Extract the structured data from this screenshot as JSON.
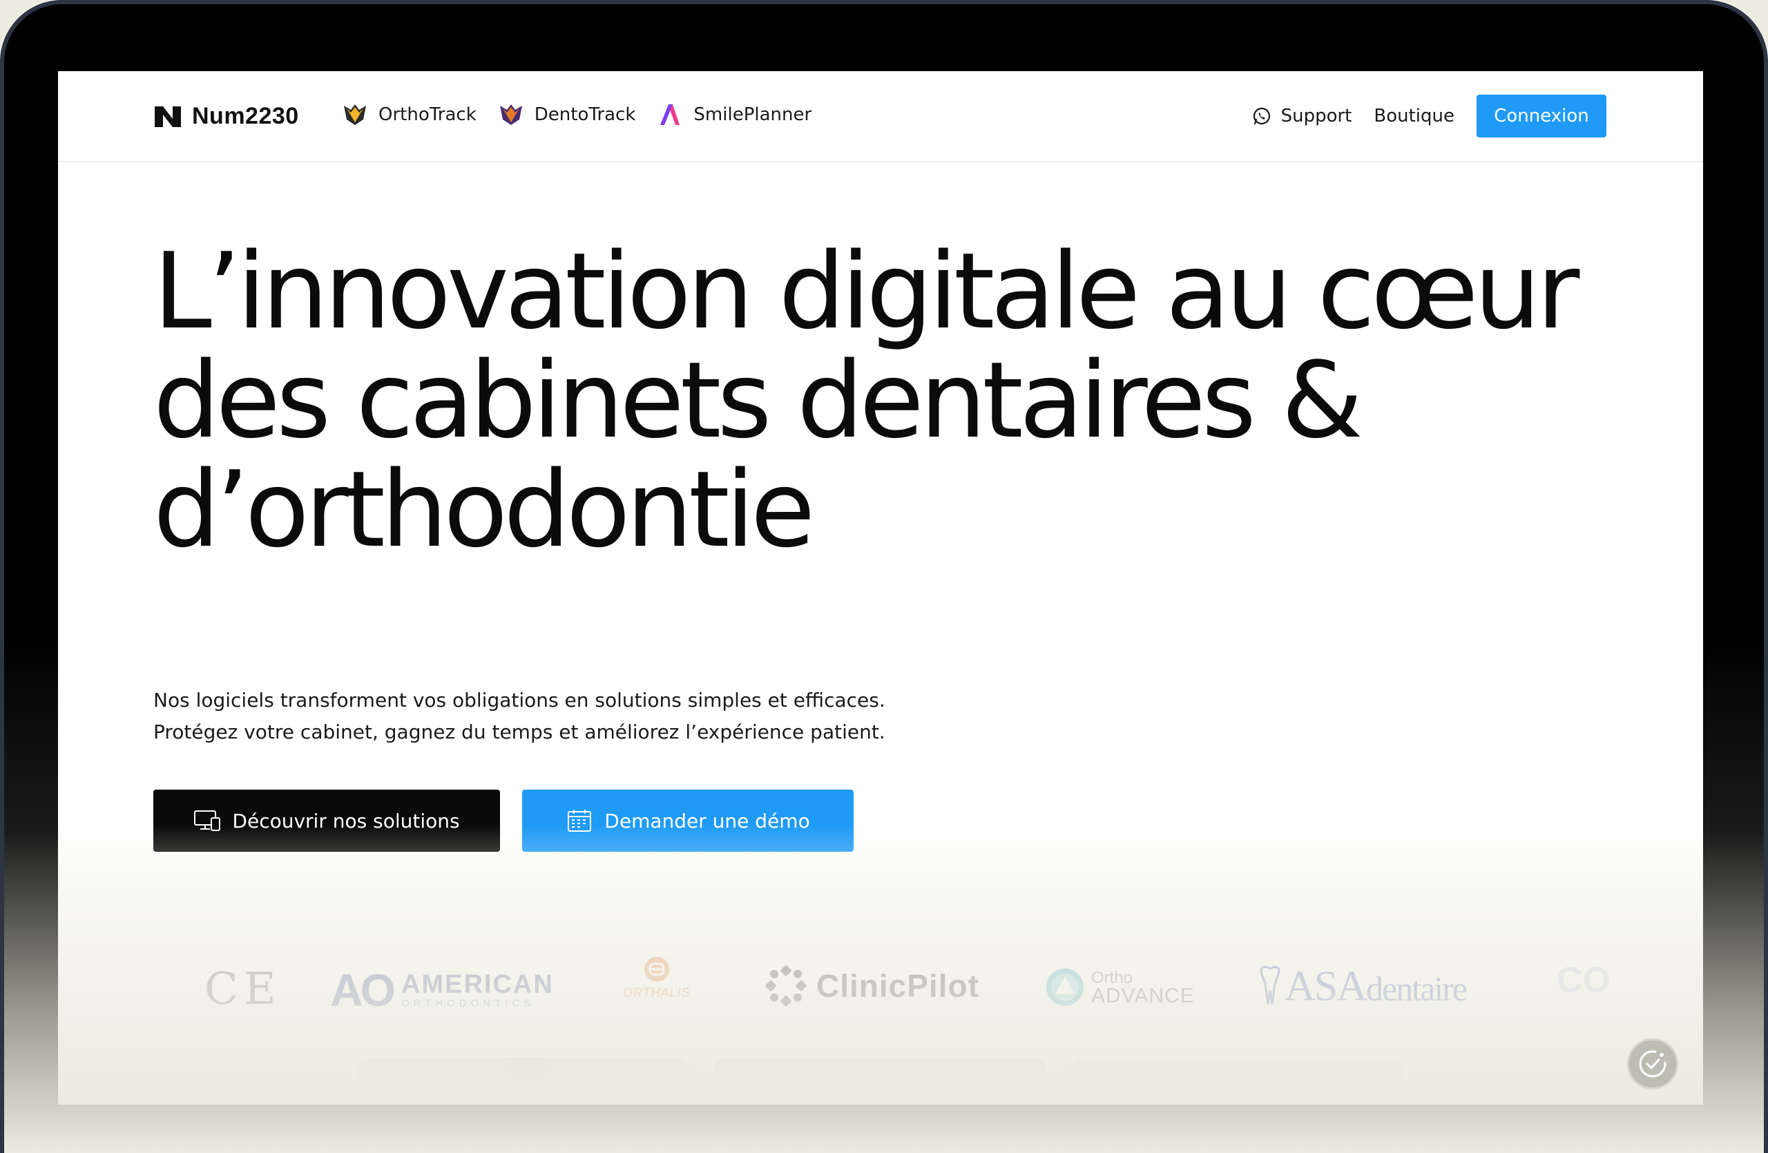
{
  "brand": {
    "name": "Num2230"
  },
  "nav": {
    "products": [
      {
        "label": "OrthoTrack",
        "icon": "orthotrack-logo-icon"
      },
      {
        "label": "DentoTrack",
        "icon": "dentotrack-logo-icon"
      },
      {
        "label": "SmilePlanner",
        "icon": "smileplanner-logo-icon"
      }
    ],
    "support_label": "Support",
    "shop_label": "Boutique",
    "login_label": "Connexion"
  },
  "hero": {
    "title_line1": "L’innovation digitale au cœur",
    "title_line2": "des cabinets dentaires &",
    "title_line3": "d’orthodontie",
    "subtitle_line1": "Nos logiciels transforment vos obligations en solutions simples et efficaces.",
    "subtitle_line2": "Protégez votre cabinet, gagnez du temps et améliorez l’expérience patient.",
    "cta_primary": "Découvrir nos solutions",
    "cta_secondary": "Demander une démo"
  },
  "partners": {
    "ce": "CE",
    "ao_mark": "AO",
    "ao_big": "AMERICAN",
    "ao_small": "ORTHODONTICS",
    "orthalis": "ORTHALIS",
    "clinicpilot": "ClinicPilot",
    "ortho_advance_small": "Ortho",
    "ortho_advance_big": "ADVANCE",
    "asa_big": "ASA",
    "asa_small": "dentaire",
    "co": "CO"
  },
  "colors": {
    "accent": "#1f9bf7",
    "dark": "#0a0a0a",
    "ao_blue": "#3a4d8f",
    "orthalis_orange": "#e8833a",
    "asa_blue": "#3a5bb2"
  }
}
